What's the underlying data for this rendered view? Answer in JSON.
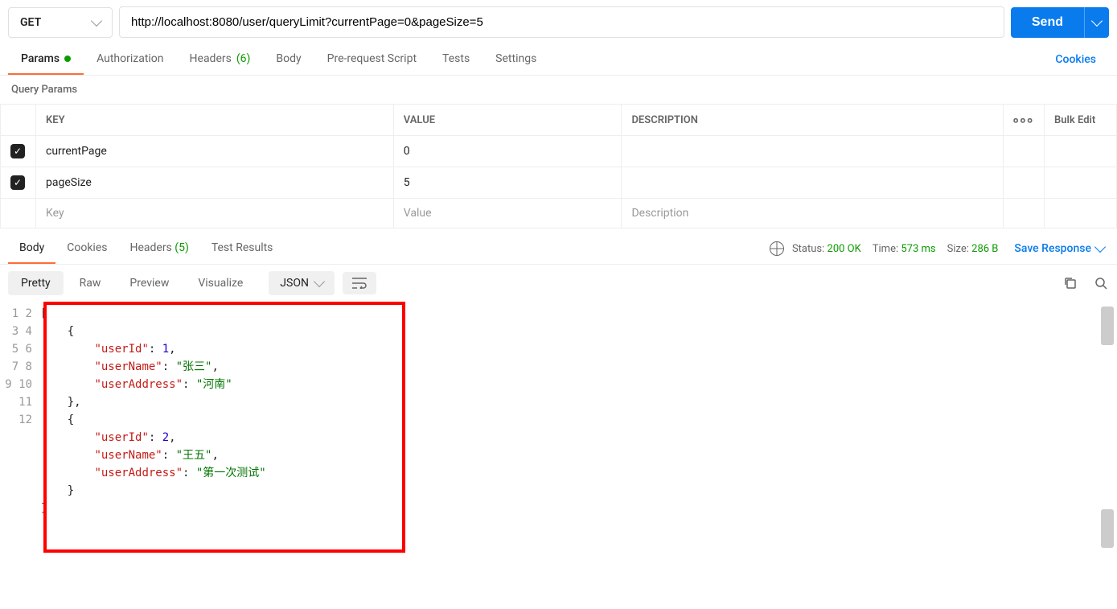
{
  "method": "GET",
  "url": "http://localhost:8080/user/queryLimit?currentPage=0&pageSize=5",
  "send_label": "Send",
  "req_tabs": {
    "params": "Params",
    "authorization": "Authorization",
    "headers": "Headers",
    "headers_count": "(6)",
    "body": "Body",
    "prerequest": "Pre-request Script",
    "tests": "Tests",
    "settings": "Settings",
    "cookies": "Cookies"
  },
  "query_params_title": "Query Params",
  "table": {
    "key_header": "KEY",
    "value_header": "VALUE",
    "desc_header": "DESCRIPTION",
    "bulk_edit": "Bulk Edit",
    "rows": [
      {
        "key": "currentPage",
        "value": "0"
      },
      {
        "key": "pageSize",
        "value": "5"
      }
    ],
    "placeholder_key": "Key",
    "placeholder_value": "Value",
    "placeholder_desc": "Description"
  },
  "resp_tabs": {
    "body": "Body",
    "cookies": "Cookies",
    "headers": "Headers",
    "headers_count": "(5)",
    "test_results": "Test Results"
  },
  "meta": {
    "status_label": "Status:",
    "status_value": "200 OK",
    "time_label": "Time:",
    "time_value": "573 ms",
    "size_label": "Size:",
    "size_value": "286 B",
    "save_response": "Save Response"
  },
  "view_tabs": {
    "pretty": "Pretty",
    "raw": "Raw",
    "preview": "Preview",
    "visualize": "Visualize",
    "format": "JSON"
  },
  "response_body": [
    {
      "userId": 1,
      "userName": "张三",
      "userAddress": "河南"
    },
    {
      "userId": 2,
      "userName": "王五",
      "userAddress": "第一次测试"
    }
  ]
}
